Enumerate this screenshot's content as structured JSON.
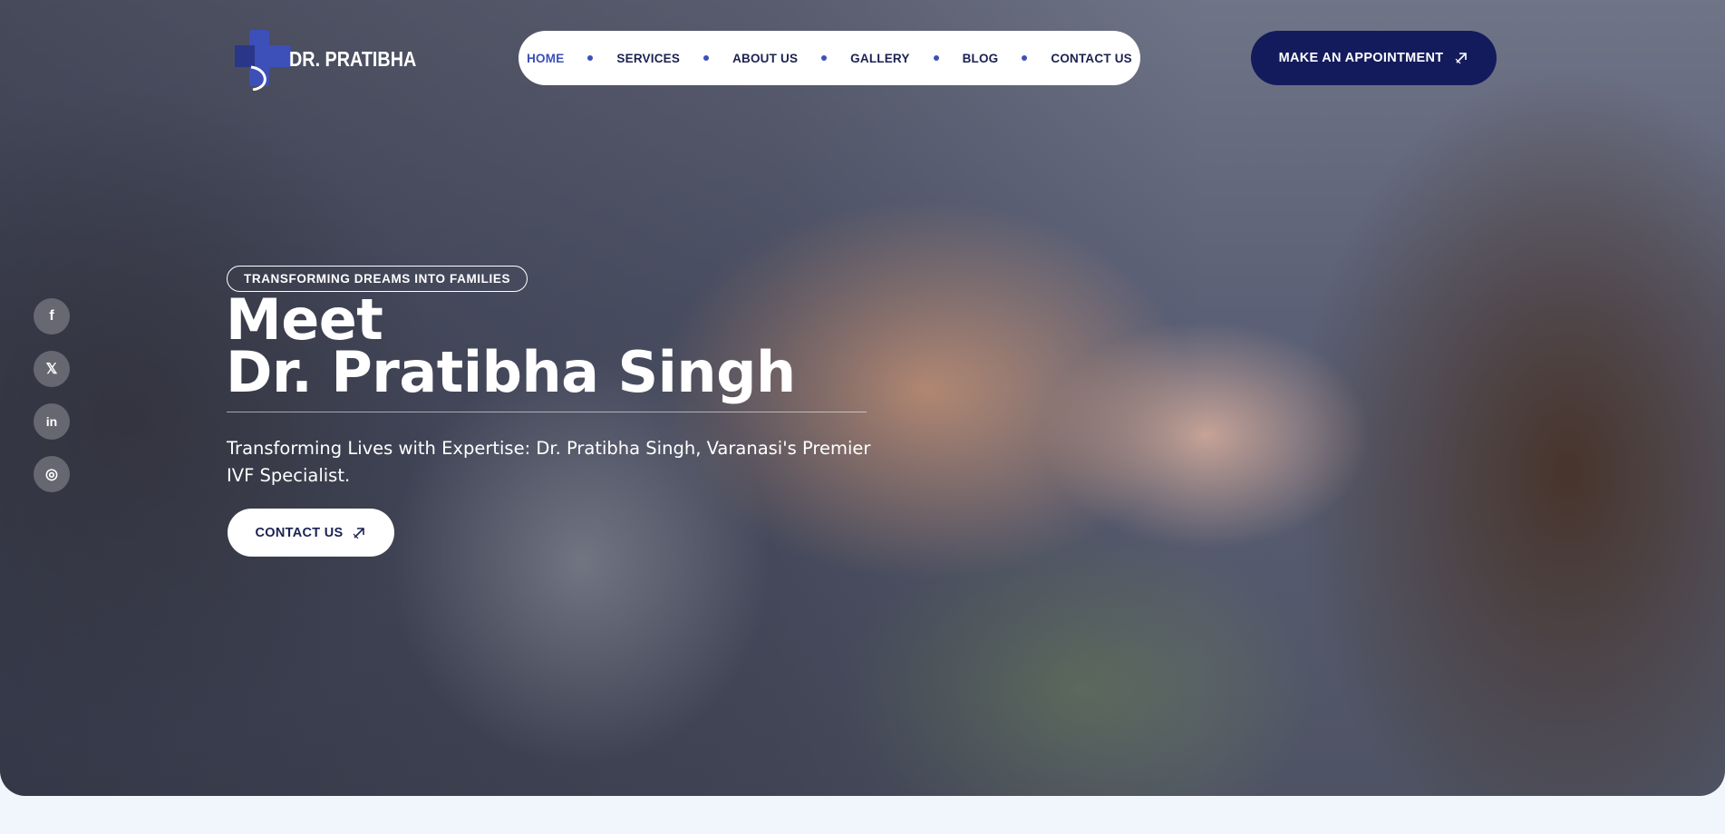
{
  "brand": {
    "name": "DR. PRATIBHA",
    "accent": "#3d4fb8",
    "navy": "#141b5c"
  },
  "nav": {
    "items": [
      {
        "label": "HOME",
        "active": true
      },
      {
        "label": "SERVICES"
      },
      {
        "label": "ABOUT US"
      },
      {
        "label": "GALLERY"
      },
      {
        "label": "BLOG"
      },
      {
        "label": "CONTACT US"
      }
    ]
  },
  "header": {
    "appointment_label": "MAKE AN APPOINTMENT",
    "appointment_icon": "arrow-up-right-icon"
  },
  "social": [
    {
      "name": "facebook-icon",
      "glyph": "f"
    },
    {
      "name": "x-twitter-icon",
      "glyph": "𝕏"
    },
    {
      "name": "linkedin-icon",
      "glyph": "in"
    },
    {
      "name": "instagram-icon",
      "glyph": "◎"
    }
  ],
  "hero": {
    "tagline": "TRANSFORMING DREAMS INTO FAMILIES",
    "heading_line1": "Meet",
    "heading_line2": "Dr. Pratibha Singh",
    "subtitle": "Transforming Lives with Expertise: Dr. Pratibha Singh, Varanasi's Premier IVF Specialist.",
    "contact_label": "CONTACT US"
  }
}
